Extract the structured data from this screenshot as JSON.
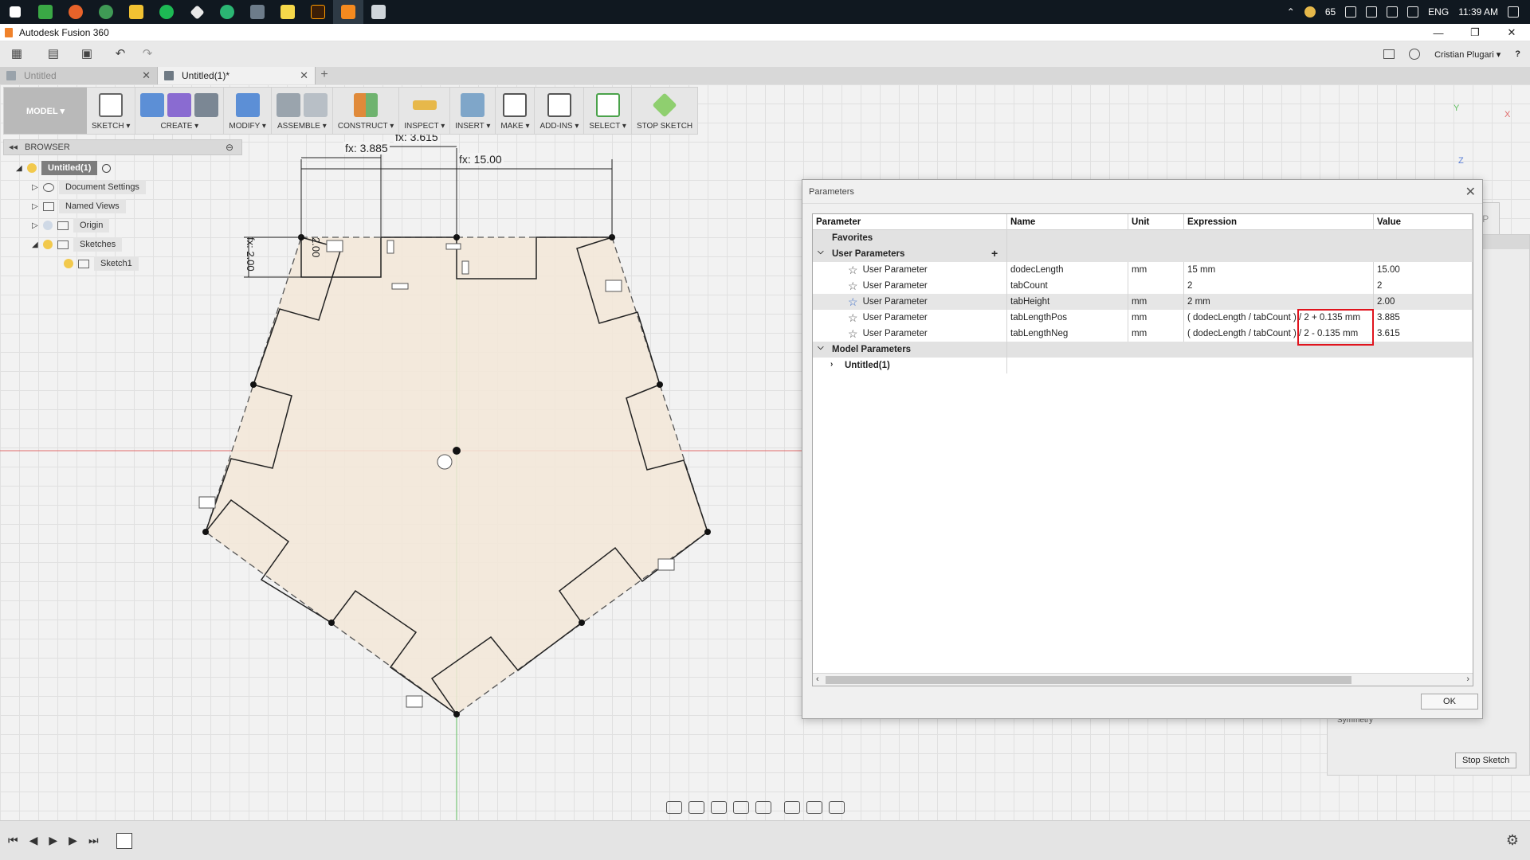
{
  "taskbar": {
    "icons": [
      "windows-start-icon",
      "app-green-icon",
      "firefox-icon",
      "chrome-icon",
      "file-explorer-icon",
      "spotify-icon",
      "git-icon",
      "app-green-circle-icon",
      "media-icon",
      "sticky-notes-icon",
      "illustrator-icon",
      "fusion-icon",
      "calculator-icon"
    ],
    "tray": {
      "temperature": "65",
      "language": "ENG",
      "time": "11:39 AM"
    }
  },
  "window": {
    "title": "Autodesk Fusion 360",
    "minimize": "—",
    "restore": "❐",
    "close": "✕"
  },
  "quickbar": {
    "user": "Cristian Plugari ▾",
    "help": "?"
  },
  "tabs": [
    {
      "label": "Untitled",
      "close": "✕"
    },
    {
      "label": "Untitled(1)*",
      "close": "✕"
    }
  ],
  "tab_add": "+",
  "toolbar": {
    "workspace": "MODEL ▾",
    "groups": [
      "SKETCH ▾",
      "CREATE ▾",
      "MODIFY ▾",
      "ASSEMBLE ▾",
      "CONSTRUCT ▾",
      "INSPECT ▾",
      "INSERT ▾",
      "MAKE ▾",
      "ADD-INS ▾",
      "SELECT ▾",
      "STOP SKETCH"
    ]
  },
  "browser": {
    "title": "BROWSER",
    "root": "Untitled(1)",
    "items": [
      "Document Settings",
      "Named Views",
      "Origin",
      "Sketches"
    ],
    "sketch": "Sketch1"
  },
  "dimensions": {
    "d1": "fx: 3.885",
    "d2": "fx: 3.615",
    "d3": "fx: 15.00",
    "d4": "fx: 2.00",
    "d5": "2.00"
  },
  "viewcube": {
    "face": "TOP",
    "y": "Y",
    "x": "X",
    "z": "Z"
  },
  "sidepanel": {
    "symmetry": "Symmetry",
    "stop_sketch": "Stop Sketch"
  },
  "dialog": {
    "title": "Parameters",
    "headers": [
      "Parameter",
      "Name",
      "Unit",
      "Expression",
      "Value"
    ],
    "sections": {
      "favorites": "Favorites",
      "user": "User Parameters",
      "model": "Model Parameters"
    },
    "rows": [
      {
        "param": "User Parameter",
        "name": "dodecLength",
        "unit": "mm",
        "expr": "15 mm",
        "value": "15.00"
      },
      {
        "param": "User Parameter",
        "name": "tabCount",
        "unit": "",
        "expr": "2",
        "value": "2"
      },
      {
        "param": "User Parameter",
        "name": "tabHeight",
        "unit": "mm",
        "expr": "2 mm",
        "value": "2.00"
      },
      {
        "param": "User Parameter",
        "name": "tabLengthPos",
        "unit": "mm",
        "expr": "( dodecLength / tabCount ) / 2 + 0.135 mm",
        "value": "3.885"
      },
      {
        "param": "User Parameter",
        "name": "tabLengthNeg",
        "unit": "mm",
        "expr": "( dodecLength / tabCount ) / 2 - 0.135 mm",
        "value": "3.615"
      }
    ],
    "model_child": "Untitled(1)",
    "ok": "OK"
  },
  "colors": {
    "highlight": "#e0141e",
    "sketch_fill": "#f3e7d8",
    "axis_red": "#e06a6a",
    "axis_green": "#5fbf5f"
  }
}
